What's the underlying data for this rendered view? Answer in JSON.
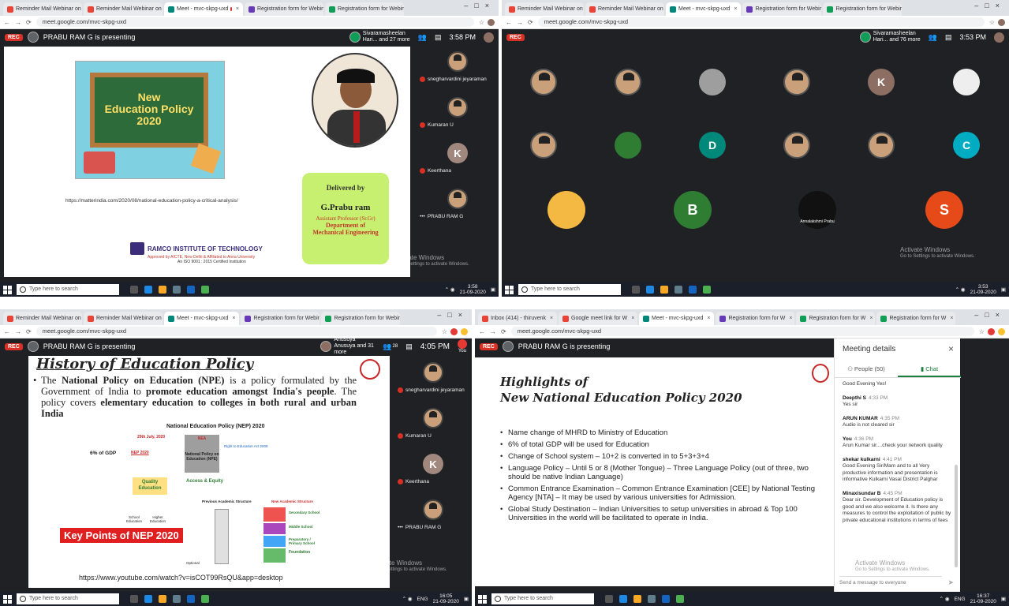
{
  "colors": {
    "rec": "#d93025",
    "meet_bg": "#202124",
    "chat_accent": "#188038",
    "nep_red": "#e02020"
  },
  "tl": {
    "tabs": [
      "Reminder Mail Webinar on N",
      "Reminder Mail Webinar on N",
      "Meet - mvc-skpg-uxd",
      "Registration form for Webinar",
      "Registration form for Webinar"
    ],
    "url": "meet.google.com/mvc-skpg-uxd",
    "rec": "REC",
    "presenting": "PRABU RAM G is presenting",
    "participants": "Sivaramasheelan Hari... and 27 more",
    "time": "3:58 PM",
    "slide": {
      "title_line1": "New",
      "title_line2": "Education Policy",
      "title_line3": "2020",
      "link": "https://matterindia.com/2020/08/national-education-policy-a-critical-analysis/",
      "delivered_by": "Delivered by",
      "speaker": "G.Prabu ram",
      "designation": "Assistant Professor (Sr.Gr)",
      "dept1": "Department of",
      "dept2": "Mechanical Engineering",
      "college": "RAMCO INSTITUTE OF TECHNOLOGY",
      "college_sub": "Approved by AICTE, New Delhi & Affiliated to Anna University",
      "college_iso": "An ISO 9001 : 2015 Certified Institution"
    },
    "side": [
      "snegharvardini jeyaraman",
      "Kumaran U",
      "Keerthana",
      "PRABU RAM G"
    ],
    "k_letter": "K",
    "watermark": "Activate Windows",
    "watermark2": "Go to Settings to activate Windows.",
    "search": "Type here to search",
    "clock": "3:58",
    "date": "21-09-2020"
  },
  "tr": {
    "tabs": [
      "Reminder Mail Webinar on N",
      "Reminder Mail Webinar on N",
      "Meet - mvc-skpg-uxd",
      "Registration form for Webinar",
      "Registration form for Webinar"
    ],
    "url": "meet.google.com/mvc-skpg-uxd",
    "rec": "REC",
    "participants": "Sivaramasheelan Hari... and 76 more",
    "time": "3:53 PM",
    "letters": {
      "k": "K",
      "d": "D",
      "c": "C",
      "b": "B",
      "s": "S"
    },
    "tile_name": "Annalakshmi Prabu",
    "watermark": "Activate Windows",
    "watermark2": "Go to Settings to activate Windows.",
    "search": "Type here to search",
    "clock": "3:53",
    "date": "21-09-2020"
  },
  "bl": {
    "tabs": [
      "Reminder Mail Webinar on N",
      "Reminder Mail Webinar on N",
      "Meet - mvc-skpg-uxd",
      "Registration form for Webinar",
      "Registration form for Webinar"
    ],
    "url": "meet.google.com/mvc-skpg-uxd",
    "rec": "REC",
    "presenting": "PRABU RAM G is presenting",
    "participants": "Anusuya Anusuya and 31 more",
    "count": "28",
    "time": "4:05 PM",
    "you": "You",
    "slide": {
      "title": "History of Education Policy",
      "b_pre": "The ",
      "b_npe": "National Policy on Education (NPE)",
      "b_mid": " is a policy formulated by the Government of India to ",
      "b_promote": "promote education amongst India's people",
      "b_mid2": ". The policy covers ",
      "b_covers": "elementary education to colleges in both rural and urban India",
      "chart_title": "National Education Policy (NEP) 2020",
      "date_label": "29th July, 2020",
      "nea": "NEA",
      "gdp": "6% of GDP",
      "nep": "NEP 2020",
      "npe": "National Policy on Education (NPE)",
      "rte": "Right to Education Act 2009",
      "quality": "Quality Education",
      "access": "Access & Equity",
      "school": "School Education",
      "higher": "Higher Education",
      "present": "Previous Academic Structure",
      "new": "New Academic Structure",
      "secondary": "Secondary School",
      "middle": "Middle School",
      "prep": "Preparatory / Primary School",
      "foundation": "Foundation",
      "optional": "Optional",
      "key_points": "Key Points of NEP 2020",
      "yt": "https://www.youtube.com/watch?v=isCOT99RsQU&app=desktop"
    },
    "side": [
      "snegharvardini jeyaraman",
      "Kumaran U",
      "Keerthana",
      "PRABU RAM G"
    ],
    "k_letter": "K",
    "watermark": "Activate Windows",
    "watermark2": "Go to Settings to activate Windows.",
    "search": "Type here to search",
    "clock": "16:05",
    "date": "21-09-2020",
    "lang": "ENG"
  },
  "br": {
    "tabs": [
      "Inbox (414) - thiruvenk",
      "Google meet link for W",
      "Meet - mvc-skpg-uxd",
      "Registration form for W",
      "Registration form for W",
      "Registration form for W"
    ],
    "url": "meet.google.com/mvc-skpg-uxd",
    "rec": "REC",
    "presenting": "PRABU RAM G is presenting",
    "slide": {
      "title1": "Highlights of",
      "title2": "New National Education Policy 2020",
      "bullets": [
        "Name change of MHRD to Ministry of Education",
        "6% of total GDP will be used for Education",
        "Change of School system – 10+2 is converted in to 5+3+3+4",
        "Language Policy – Until 5 or 8 (Mother Tongue) – Three Language Policy (out of three, two should be native Indian Language)",
        "Common Entrance Examination – Common Entrance Examination [CEE] by National Testing Agency [NTA] – It may be used by various universities for Admission.",
        "Global Study Destination – Indian Universities to setup universities in abroad & Top 100 Universities in the world will be facilitated to operate in India."
      ]
    },
    "panel": {
      "title": "Meeting details",
      "people": "People (50)",
      "chat": "Chat",
      "msgs": [
        {
          "name": "",
          "time": "",
          "text": "Good Evening Yes!"
        },
        {
          "name": "Deepthi S",
          "time": "4:33 PM",
          "text": "Yes sir"
        },
        {
          "name": "ARUN KUMAR",
          "time": "4:35 PM",
          "text": "Audio is not cleared sir"
        },
        {
          "name": "You",
          "time": "4:36 PM",
          "text": "Arun Kumar sir....check your network quality"
        },
        {
          "name": "shekar kulkarni",
          "time": "4:41 PM",
          "text": "Good Evening Sir/Mam and to all Very productive information and presentation is informative Kulkarni Vasai District Palghar"
        },
        {
          "name": "Minaxisundar B",
          "time": "4:45 PM",
          "text": "Dear sir. Development of Education policy is good and we also welcome it. Is there any measures to control the exploitation of public by private educational institutions in terms of fees"
        }
      ],
      "input_placeholder": "Send a message to everyone"
    },
    "watermark": "Activate Windows",
    "watermark2": "Go to Settings to activate Windows.",
    "search": "Type here to search",
    "clock": "16:37",
    "date": "21-09-2020",
    "lang": "ENG"
  }
}
